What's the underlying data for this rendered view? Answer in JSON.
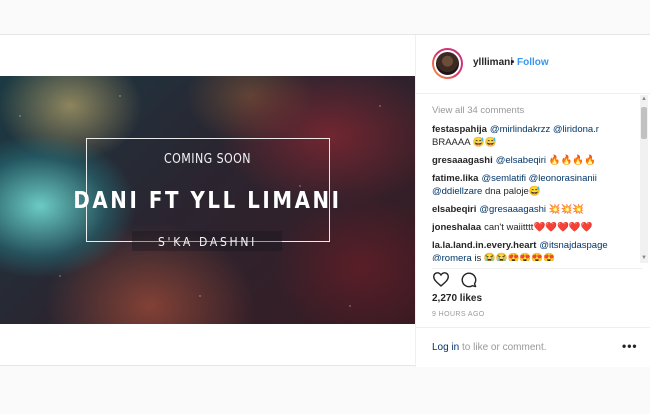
{
  "post": {
    "image": {
      "coming_soon": "COMING SOON",
      "title": "DANI FT YLL LIMANI",
      "subtitle": "S'KA DASHNI"
    },
    "header": {
      "username": "ylllimani",
      "separator": "•",
      "follow_label": "Follow",
      "avatar_icon": "profile-avatar"
    },
    "view_all_comments": "View all 34 comments",
    "comments": [
      {
        "user": "festaspahija",
        "parts": [
          {
            "t": "@mirlindakrzz",
            "m": true
          },
          {
            "t": " ",
            "m": false
          },
          {
            "t": "@liridona.r",
            "m": true
          },
          {
            "t": " BRAAAA 😅😅",
            "m": false
          }
        ]
      },
      {
        "user": "gresaaagashi",
        "parts": [
          {
            "t": "@elsabeqiri",
            "m": true
          },
          {
            "t": " 🔥🔥🔥🔥",
            "m": false
          }
        ]
      },
      {
        "user": "fatime.lika",
        "parts": [
          {
            "t": "@semlatifi",
            "m": true
          },
          {
            "t": " ",
            "m": false
          },
          {
            "t": "@leonorasinanii",
            "m": true
          },
          {
            "t": " ",
            "m": false
          },
          {
            "t": "@ddiellzare",
            "m": true
          },
          {
            "t": " dna paloje😅",
            "m": false
          }
        ]
      },
      {
        "user": "elsabeqiri",
        "parts": [
          {
            "t": "@gresaaagashi",
            "m": true
          },
          {
            "t": " 💥💥💥",
            "m": false
          }
        ]
      },
      {
        "user": "joneshalaa",
        "parts": [
          {
            "t": "can't waiitttt❤️❤️❤️❤️❤️",
            "m": false
          }
        ]
      },
      {
        "user": "la.la.land.in.every.heart",
        "parts": [
          {
            "t": "@itsnajdaspage",
            "m": true
          },
          {
            "t": " ",
            "m": false
          },
          {
            "t": "@romera",
            "m": true
          },
          {
            "t": " is 😭😭😍😍😍😍",
            "m": false
          }
        ]
      }
    ],
    "likes": "2,270 likes",
    "time_ago": "9 HOURS AGO",
    "login_prompt": {
      "link": "Log in",
      "rest": " to like or comment."
    },
    "more_label": "•••",
    "icons": {
      "like": "heart-icon",
      "comment": "comment-icon",
      "more": "more-options-icon"
    },
    "colors": {
      "accent": "#3897f0",
      "mention": "#003569",
      "muted": "#999999"
    }
  }
}
